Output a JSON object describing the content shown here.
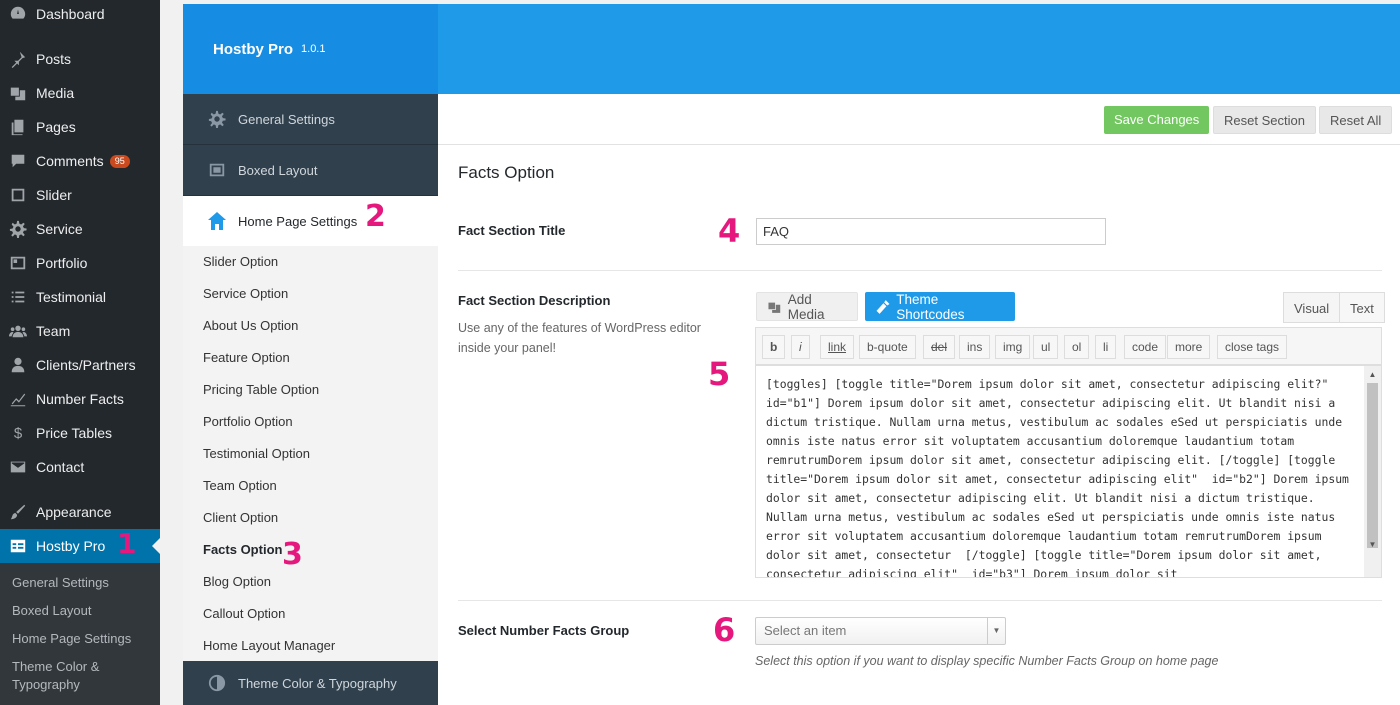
{
  "wp_menu": {
    "items": [
      {
        "label": "Dashboard",
        "icon": "dashboard-icon"
      },
      {
        "label": "Posts",
        "icon": "pin-icon"
      },
      {
        "label": "Media",
        "icon": "media-icon"
      },
      {
        "label": "Pages",
        "icon": "pages-icon"
      },
      {
        "label": "Comments",
        "icon": "comment-icon",
        "badge": "95"
      },
      {
        "label": "Slider",
        "icon": "slider-icon"
      },
      {
        "label": "Service",
        "icon": "gear-icon"
      },
      {
        "label": "Portfolio",
        "icon": "portfolio-icon"
      },
      {
        "label": "Testimonial",
        "icon": "list-icon"
      },
      {
        "label": "Team",
        "icon": "team-icon"
      },
      {
        "label": "Clients/Partners",
        "icon": "user-icon"
      },
      {
        "label": "Number Facts",
        "icon": "chart-icon"
      },
      {
        "label": "Price Tables",
        "icon": "dollar-icon"
      },
      {
        "label": "Contact",
        "icon": "envelope-icon"
      },
      {
        "label": "Appearance",
        "icon": "brush-icon"
      },
      {
        "label": "Hostby Pro",
        "icon": "table-icon"
      }
    ],
    "submenu": [
      "General Settings",
      "Boxed Layout",
      "Home Page Settings",
      "Theme Color & Typography"
    ]
  },
  "markers": [
    "1",
    "2",
    "3",
    "4",
    "5",
    "6"
  ],
  "panel": {
    "brand_name": "Hostby Pro",
    "version": "1.0.1",
    "nav": {
      "general": "General Settings",
      "boxed": "Boxed Layout",
      "home": "Home Page Settings",
      "subitems": [
        "Slider Option",
        "Service Option",
        "About Us Option",
        "Feature Option",
        "Pricing Table Option",
        "Portfolio Option",
        "Testimonial Option",
        "Team Option",
        "Client Option",
        "Facts Option",
        "Blog Option",
        "Callout Option",
        "Home Layout Manager"
      ],
      "theme": "Theme Color & Typography"
    },
    "actions": {
      "save": "Save Changes",
      "reset_section": "Reset Section",
      "reset_all": "Reset All"
    },
    "section_title": "Facts Option",
    "fact_title": {
      "label": "Fact Section Title",
      "value": "FAQ"
    },
    "fact_desc": {
      "label": "Fact Section Description",
      "help": "Use any of the features of WordPress editor inside your panel!",
      "add_media": "Add Media",
      "theme_shortcodes": "Theme Shortcodes",
      "tab_visual": "Visual",
      "tab_text": "Text",
      "quicktags": [
        "b",
        "i",
        "link",
        "b-quote",
        "del",
        "ins",
        "img",
        "ul",
        "ol",
        "li",
        "code",
        "more",
        "close tags"
      ],
      "content": "[toggles] [toggle title=\"Dorem ipsum dolor sit amet, consectetur adipiscing elit?\" id=\"b1\"] Dorem ipsum dolor sit amet, consectetur adipiscing elit. Ut blandit nisi a dictum tristique. Nullam urna metus, vestibulum ac sodales eSed ut perspiciatis unde omnis iste natus error sit voluptatem accusantium doloremque laudantium totam remrutrumDorem ipsum dolor sit amet, consectetur adipiscing elit. [/toggle] [toggle title=\"Dorem ipsum dolor sit amet, consectetur adipiscing elit\"  id=\"b2\"] Dorem ipsum dolor sit amet, consectetur adipiscing elit. Ut blandit nisi a dictum tristique. Nullam urna metus, vestibulum ac sodales eSed ut perspiciatis unde omnis iste natus error sit voluptatem accusantium doloremque laudantium totam remrutrumDorem ipsum dolor sit amet, consectetur  [/toggle] [toggle title=\"Dorem ipsum dolor sit amet, consectetur adipiscing elit\"  id=\"b3\"] Dorem ipsum dolor sit"
    },
    "facts_group": {
      "label": "Select Number Facts Group",
      "placeholder": "Select an item",
      "help": "Select this option if you want to display specific Number Facts Group on home page"
    }
  },
  "colors": {
    "accent": "#1e9ae8",
    "save": "#72c760",
    "marker": "#e5197d",
    "wp_current": "#0073aa"
  }
}
